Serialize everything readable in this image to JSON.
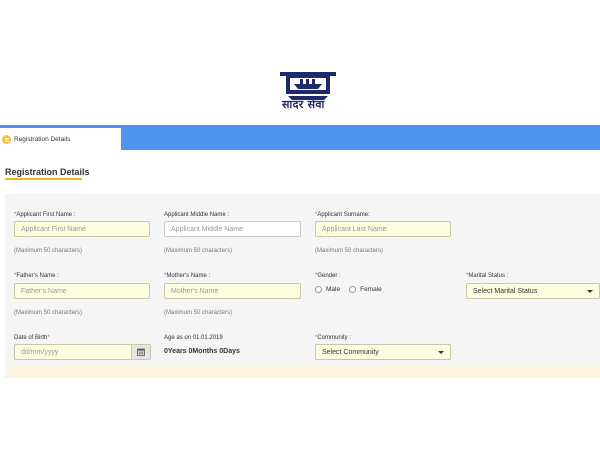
{
  "header": {
    "logo_text": "सादर सेवा",
    "logo_icon": "ship-emblem-icon",
    "brand_color": "#1f2a6b"
  },
  "tabs": [
    {
      "label": "Registration Details",
      "icon": "registration-icon"
    }
  ],
  "section": {
    "title": "Registration Details",
    "accent_color": "#f2b625"
  },
  "form": {
    "first_name": {
      "label": "Applicant First Name :",
      "required": "*",
      "placeholder": "Applicant First Name",
      "hint": "(Maximum 50 characters)"
    },
    "middle_name": {
      "label": "Applicant Middle Name :",
      "placeholder": "Applicant Middle Name",
      "hint": "(Maximum 50 characters)"
    },
    "surname": {
      "label": "Applicant Surname:",
      "required": "*",
      "placeholder": "Applicant Last Name",
      "hint": "(Maximum 50 characters)"
    },
    "father_name": {
      "label": "Father's Name :",
      "required": "*",
      "placeholder": "Father's Name",
      "hint": "(Maximum 50 characters)"
    },
    "mother_name": {
      "label": "Mother's Name :",
      "required": "*",
      "placeholder": "Mother's Name",
      "hint": "(Maximum 50 characters)"
    },
    "gender": {
      "label": "Gender :",
      "required": "*",
      "options": [
        "Male",
        "Female"
      ]
    },
    "marital_status": {
      "label": "Marital Status :",
      "required": "*",
      "selected": "Select Marital Status"
    },
    "dob": {
      "label": "Date of Birth",
      "required": "*",
      "placeholder": "dd/mm/yyyy"
    },
    "age": {
      "label": "Age as on 01.01.2019",
      "value": "0Years  0Months  0Days"
    },
    "community": {
      "label": "Community :",
      "required": "*",
      "selected": "Select Community"
    }
  },
  "colors": {
    "tabbar": "#4f94f0",
    "input_bg": "#fffde0",
    "required": "#d9534f"
  }
}
